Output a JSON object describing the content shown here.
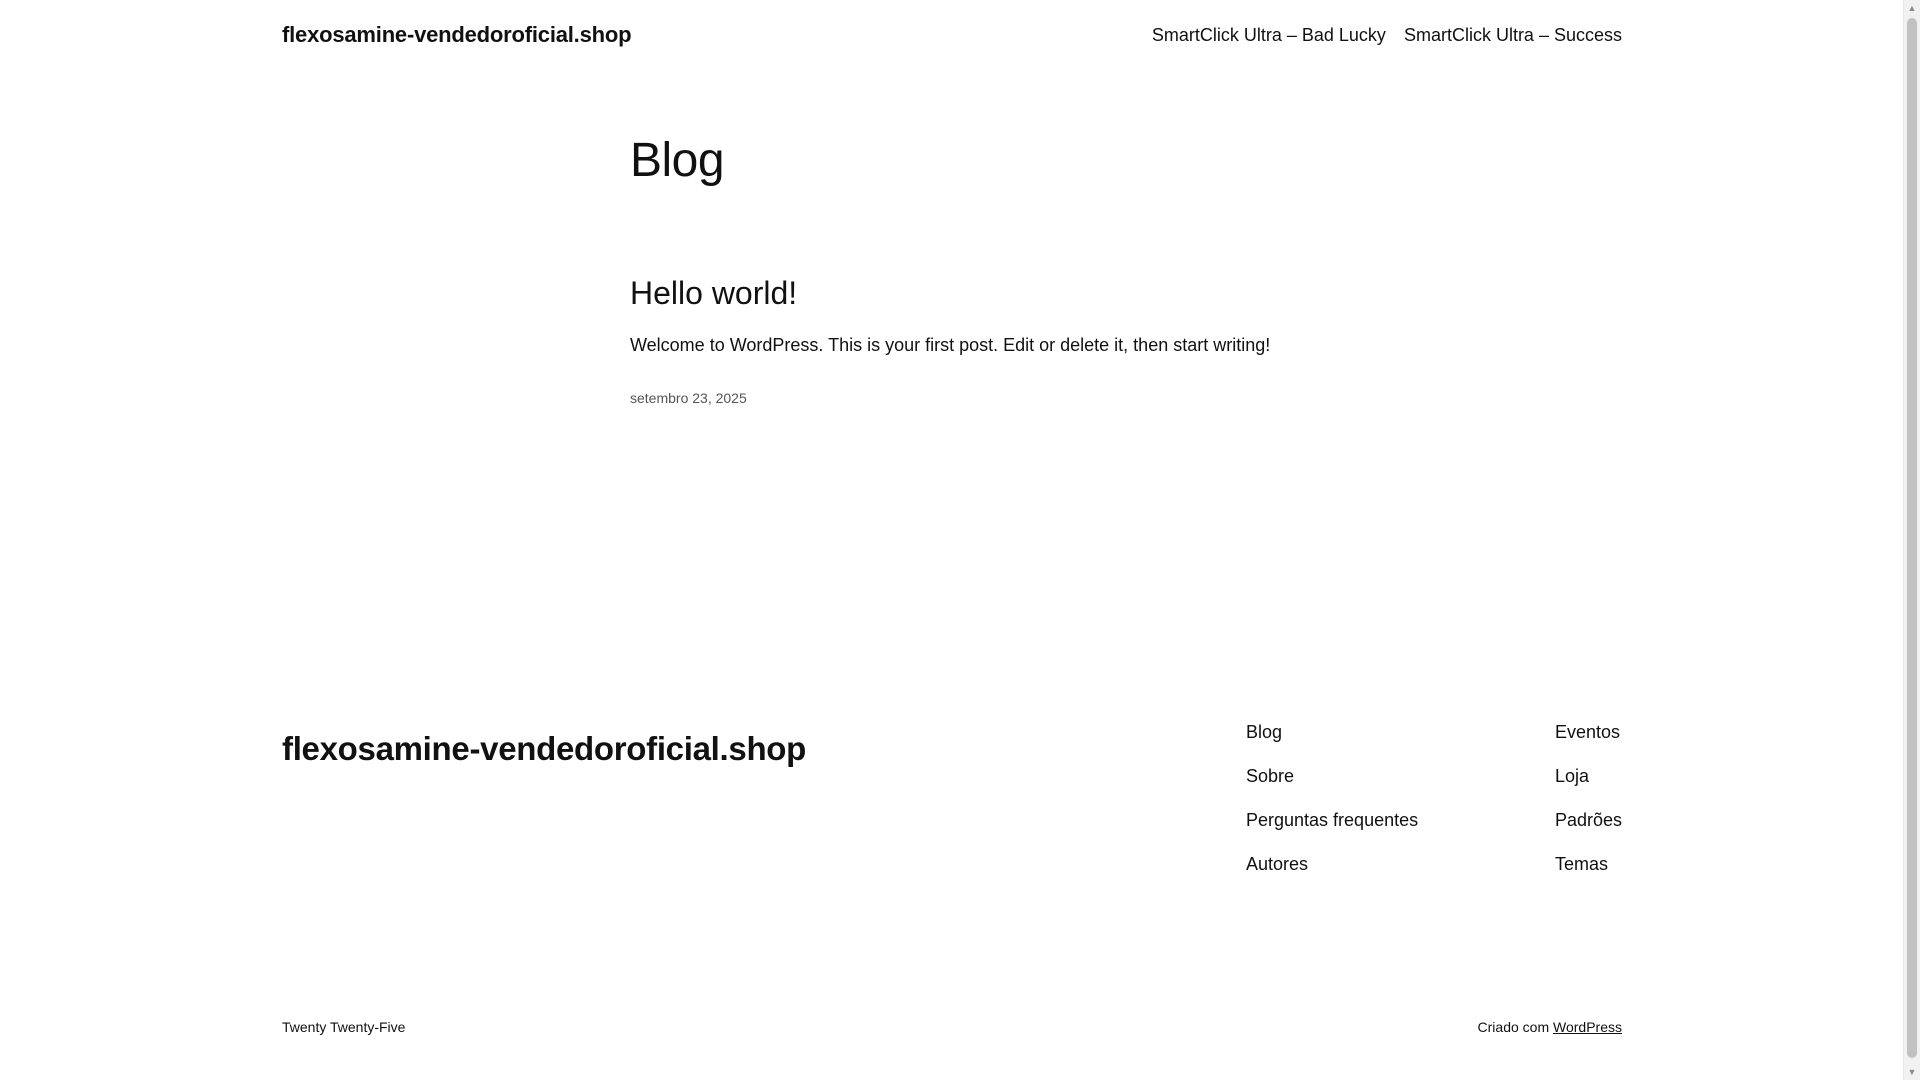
{
  "header": {
    "site_title": "flexosamine-vendedoroficial.shop",
    "nav": [
      {
        "label": "SmartClick Ultra – Bad Lucky"
      },
      {
        "label": "SmartClick Ultra – Success"
      }
    ]
  },
  "main": {
    "heading": "Blog",
    "posts": [
      {
        "title": "Hello world!",
        "excerpt": "Welcome to WordPress. This is your first post. Edit or delete it, then start writing!",
        "date": "setembro 23, 2025"
      }
    ]
  },
  "footer": {
    "site_title": "flexosamine-vendedoroficial.shop",
    "nav_col_1": [
      {
        "label": "Blog"
      },
      {
        "label": "Sobre"
      },
      {
        "label": "Perguntas frequentes"
      },
      {
        "label": "Autores"
      }
    ],
    "nav_col_2": [
      {
        "label": "Eventos"
      },
      {
        "label": "Loja"
      },
      {
        "label": "Padrões"
      },
      {
        "label": "Temas"
      }
    ],
    "theme_credit": "Twenty Twenty-Five",
    "powered_prefix": "Criado com",
    "powered_link": "WordPress"
  }
}
